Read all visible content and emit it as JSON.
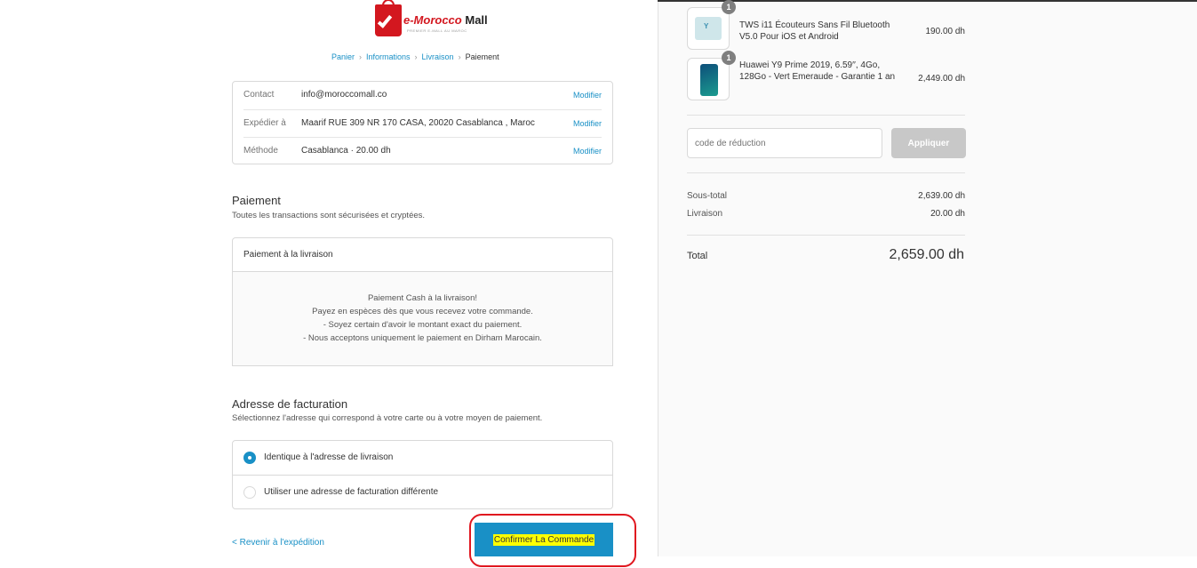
{
  "brand": {
    "name_part1": "e-Morocco",
    "name_part2": "Mall",
    "tagline": "PREMIER E-MALL AU MAROC"
  },
  "breadcrumb": {
    "cart": "Panier",
    "info": "Informations",
    "shipping": "Livraison",
    "payment": "Paiement"
  },
  "review": {
    "contact_label": "Contact",
    "contact_value": "info@moroccomall.co",
    "ship_label": "Expédier à",
    "ship_value": "Maarif RUE 309 NR 170 CASA, 20020 Casablanca , Maroc",
    "method_label": "Méthode",
    "method_value": "Casablanca · 20.00 dh",
    "modify": "Modifier"
  },
  "payment": {
    "title": "Paiement",
    "subtitle": "Toutes les transactions sont sécurisées et cryptées.",
    "option": "Paiement à la livraison",
    "info": [
      "Paiement Cash à la livraison!",
      "Payez en espèces dès que vous recevez votre commande.",
      "- Soyez certain d'avoir le montant exact du paiement.",
      "- Nous acceptons uniquement le paiement en Dirham Marocain."
    ]
  },
  "billing": {
    "title": "Adresse de facturation",
    "subtitle": "Sélectionnez l'adresse qui correspond à votre carte ou à votre moyen de paiement.",
    "same": "Identique à l'adresse de livraison",
    "different": "Utiliser une adresse de facturation différente"
  },
  "actions": {
    "back": "< Revenir à l'expédition",
    "confirm": "Confirmer La Commande"
  },
  "order": {
    "items": [
      {
        "qty": "1",
        "name": "TWS i11 Écouteurs Sans Fil Bluetooth V5.0 Pour iOS et Android",
        "price": "190.00 dh"
      },
      {
        "qty": "1",
        "name": "Huawei Y9 Prime 2019, 6.59′′, 4Go, 128Go - Vert Emeraude - Garantie 1 an",
        "price": "2,449.00 dh"
      }
    ],
    "coupon_placeholder": "code de réduction",
    "apply": "Appliquer",
    "subtotal_label": "Sous-total",
    "subtotal": "2,639.00 dh",
    "shipping_label": "Livraison",
    "shipping": "20.00 dh",
    "total_label": "Total",
    "total": "2,659.00 dh"
  },
  "colors": {
    "accent": "#1990c6",
    "brand_red": "#d3171f",
    "highlight": "#ffff00",
    "annotation": "#e0171f"
  }
}
